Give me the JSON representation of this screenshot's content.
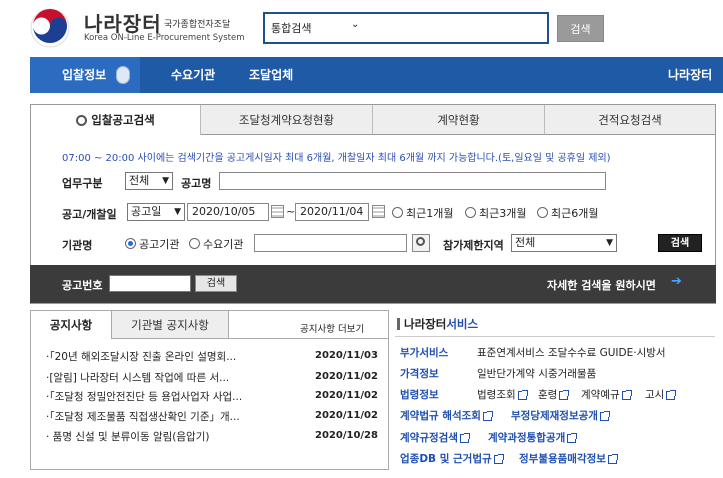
{
  "header": {
    "logo_title": "나라장터",
    "logo_subtitle": "국가종합전자조달",
    "logo_english": "Korea ON-Line E-Procurement System",
    "search_select": "통합검색",
    "search_button": "검색"
  },
  "nav": {
    "items": [
      "입찰정보",
      "수요기관",
      "조달업체"
    ],
    "right": "나라장터 소"
  },
  "tabs": [
    "입찰공고검색",
    "조달청계약요청현황",
    "계약현황",
    "견적요청검색"
  ],
  "form": {
    "notice": "07:00 ~ 20:00 사이에는 검색기간을 공고게시일자 최대 6개월, 개찰일자 최대 6개월 까지 가능합니다.(토,일요일 및 공휴일 제외)",
    "category_label": "업무구분",
    "category_value": "전체",
    "title_label": "공고명",
    "date_label": "공고/개찰일",
    "date_type": "공고일",
    "date_from": "2020/10/05",
    "tilde": "~",
    "date_to": "2020/11/04",
    "period_options": [
      "최근1개월",
      "최근3개월",
      "최근6개월"
    ],
    "agency_label": "기관명",
    "agency_options": [
      "공고기관",
      "수요기관"
    ],
    "region_label": "참가제한지역",
    "region_value": "전체",
    "search_button": "검색"
  },
  "darkbar": {
    "number_label": "공고번호",
    "search_button": "검색",
    "detail_link": "자세한 검색을 원하시면"
  },
  "notices": {
    "tab_active": "공지사항",
    "tab_inactive": "기관별 공지사항",
    "more": "공지사항 더보기",
    "rows": [
      {
        "title": "·「20년 해외조달시장 진출 온라인 설명회...",
        "date": "2020/11/03"
      },
      {
        "title": "·[알림] 나라장터 시스템 작업에 따른 서...",
        "date": "2020/11/02"
      },
      {
        "title": "·「조달청 정밀안전진단 등 용업사업자 사업...",
        "date": "2020/11/02"
      },
      {
        "title": "·「조달청 제조물품 직접생산확인 기준」개...",
        "date": "2020/11/02"
      },
      {
        "title": "· 품명 신설 및 분류이동 알림(음압기)",
        "date": "2020/10/28"
      }
    ]
  },
  "services": {
    "title_brand": "나라장터",
    "title_rest": "서비스",
    "rows": [
      {
        "cat": "부가서비스",
        "links": [
          "표준연계서비스 조달수수료 GUIDE·시방서"
        ]
      },
      {
        "cat": "가격정보",
        "links": [
          "일반단가계약 시중거래물품"
        ]
      },
      {
        "cat": "법령정보",
        "links": [
          "법령조회",
          "훈령",
          "계약예규",
          "고시"
        ]
      }
    ],
    "blue_rows": [
      [
        "계약법규 해석조회",
        "부정당제재정보공개"
      ],
      [
        "계약규정검색",
        "계약과정통합공개"
      ],
      [
        "업종DB 및 근거법규",
        "정부불용품매각정보"
      ]
    ]
  }
}
